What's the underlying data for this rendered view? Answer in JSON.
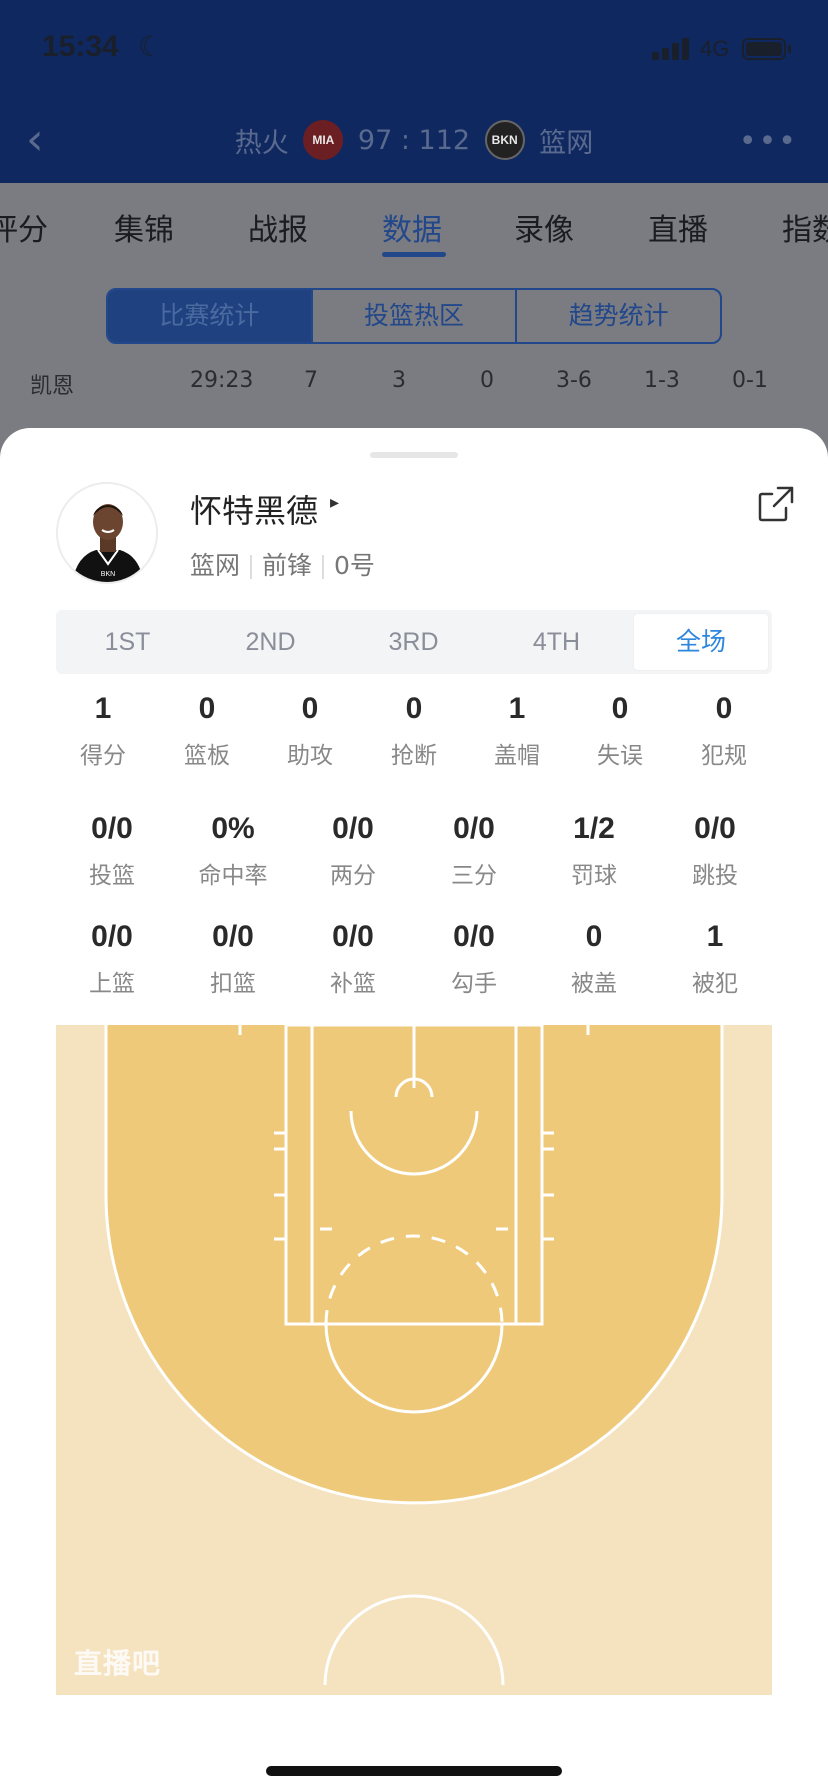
{
  "status_bar": {
    "time": "15:34",
    "network": "4G"
  },
  "nav": {
    "back_icon": "chevron-left-icon",
    "home_team": "热火",
    "home_logo": "MIA",
    "score": "97 : 112",
    "away_logo": "BKN",
    "away_team": "篮网",
    "more_icon": "more-icon"
  },
  "main_tabs": [
    "评分",
    "集锦",
    "战报",
    "数据",
    "录像",
    "直播",
    "指数"
  ],
  "active_main_tab": "数据",
  "segments": [
    "比赛统计",
    "投篮热区",
    "趋势统计"
  ],
  "bg_row": {
    "name": "凯恩",
    "values": [
      "29:23",
      "7",
      "3",
      "0",
      "3-6",
      "1-3",
      "0-1"
    ]
  },
  "player": {
    "name": "怀特黑德",
    "team": "篮网",
    "position": "前锋",
    "number": "0号"
  },
  "quarters": [
    "1ST",
    "2ND",
    "3RD",
    "4TH",
    "全场"
  ],
  "active_quarter": "全场",
  "stats_row1": [
    {
      "value": "1",
      "label": "得分"
    },
    {
      "value": "0",
      "label": "篮板"
    },
    {
      "value": "0",
      "label": "助攻"
    },
    {
      "value": "0",
      "label": "抢断"
    },
    {
      "value": "1",
      "label": "盖帽"
    },
    {
      "value": "0",
      "label": "失误"
    },
    {
      "value": "0",
      "label": "犯规"
    }
  ],
  "stats_row2": [
    {
      "value": "0/0",
      "label": "投篮"
    },
    {
      "value": "0%",
      "label": "命中率"
    },
    {
      "value": "0/0",
      "label": "两分"
    },
    {
      "value": "0/0",
      "label": "三分"
    },
    {
      "value": "1/2",
      "label": "罚球"
    },
    {
      "value": "0/0",
      "label": "跳投"
    }
  ],
  "stats_row3": [
    {
      "value": "0/0",
      "label": "上篮"
    },
    {
      "value": "0/0",
      "label": "扣篮"
    },
    {
      "value": "0/0",
      "label": "补篮"
    },
    {
      "value": "0/0",
      "label": "勾手"
    },
    {
      "value": "0",
      "label": "被盖"
    },
    {
      "value": "1",
      "label": "被犯"
    }
  ],
  "watermark": "直播吧",
  "colors": {
    "header_bg": "#0f2860",
    "accent_blue": "#2e86de",
    "court_inner": "#efc97a",
    "court_outer": "#f5e2bf"
  }
}
